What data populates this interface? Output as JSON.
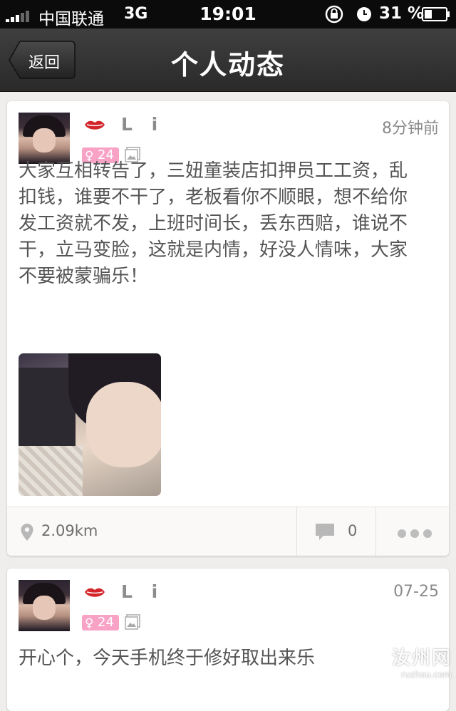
{
  "status_bar": {
    "carrier": "中国联通",
    "network": "3G",
    "time": "19:01",
    "battery": "31 %"
  },
  "nav": {
    "back_label": "返回",
    "title": "个人动态"
  },
  "posts": [
    {
      "username": "L i",
      "time": "8分钟前",
      "age_badge": "24",
      "text": "大家互相转告了，三妞童装店扣押员工工资，乱扣钱，谁要不干了，老板看你不顺眼，想不给你发工资就不发，上班时间长，丢东西赔，谁说不干，立马变脸，这就是内情，好没人情味，大家不要被蒙骗乐！",
      "distance": "2.09km",
      "comment_count": "0"
    },
    {
      "username": "L i",
      "time": "07-25",
      "age_badge": "24",
      "text": "开心个，今天手机终于修好取出来乐"
    }
  ],
  "icons": {
    "female": "♀",
    "lips_color": "#d4252b",
    "badge_color": "#f8a2c6"
  },
  "watermark": {
    "main": "汝州网",
    "sub": "ruzhou.com"
  }
}
